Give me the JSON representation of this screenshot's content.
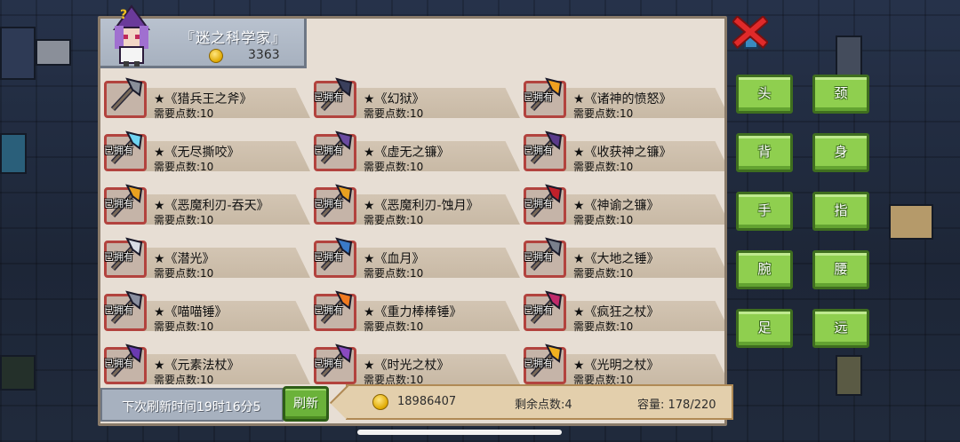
{
  "shop": {
    "title": "『迷之科学家』",
    "coins": "3363"
  },
  "items": [
    {
      "name": "★《猎兵王之斧》",
      "cost": "需要点数:10",
      "owned": "",
      "icon": "axe-icon",
      "color": "#8a8f99"
    },
    {
      "name": "★《幻狱》",
      "cost": "需要点数:10",
      "owned": "已拥有",
      "icon": "scythe-icon",
      "color": "#3a3f5c"
    },
    {
      "name": "★《诸神的愤怒》",
      "cost": "需要点数:10",
      "owned": "已拥有",
      "icon": "lightning-spear-icon",
      "color": "#f0a020"
    },
    {
      "name": "★《无尽撕咬》",
      "cost": "需要点数:10",
      "owned": "已拥有",
      "icon": "ice-blade-icon",
      "color": "#6fd4f2"
    },
    {
      "name": "★《虚无之镰》",
      "cost": "需要点数:10",
      "owned": "已拥有",
      "icon": "void-scythe-icon",
      "color": "#6a4aa0"
    },
    {
      "name": "★《收获神之镰》",
      "cost": "需要点数:10",
      "owned": "已拥有",
      "icon": "harvest-scythe-icon",
      "color": "#5a3a8a"
    },
    {
      "name": "★《恶魔利刃-吞天》",
      "cost": "需要点数:10",
      "owned": "已拥有",
      "icon": "demon-blade-icon",
      "color": "#e8a020"
    },
    {
      "name": "★《恶魔利刃-蚀月》",
      "cost": "需要点数:10",
      "owned": "已拥有",
      "icon": "demon-blade-icon",
      "color": "#e8a020"
    },
    {
      "name": "★《神谕之镰》",
      "cost": "需要点数:10",
      "owned": "已拥有",
      "icon": "oracle-scythe-icon",
      "color": "#c0202a"
    },
    {
      "name": "★《潜光》",
      "cost": "需要点数:10",
      "owned": "已拥有",
      "icon": "light-scythe-icon",
      "color": "#d8dce4"
    },
    {
      "name": "★《血月》",
      "cost": "需要点数:10",
      "owned": "已拥有",
      "icon": "blood-moon-icon",
      "color": "#3a7ac8"
    },
    {
      "name": "★《大地之锤》",
      "cost": "需要点数:10",
      "owned": "已拥有",
      "icon": "hammer-icon",
      "color": "#7a7f8c"
    },
    {
      "name": "★《喵喵锤》",
      "cost": "需要点数:10",
      "owned": "已拥有",
      "icon": "cat-hammer-icon",
      "color": "#8a8fa0"
    },
    {
      "name": "★《重力棒棒锤》",
      "cost": "需要点数:10",
      "owned": "已拥有",
      "icon": "gravity-hammer-icon",
      "color": "#f07a20"
    },
    {
      "name": "★《疯狂之杖》",
      "cost": "需要点数:10",
      "owned": "已拥有",
      "icon": "mad-staff-icon",
      "color": "#c02a6a"
    },
    {
      "name": "★《元素法杖》",
      "cost": "需要点数:10",
      "owned": "已拥有",
      "icon": "element-staff-icon",
      "color": "#6a3ab0"
    },
    {
      "name": "★《时光之杖》",
      "cost": "需要点数:10",
      "owned": "已拥有",
      "icon": "time-staff-icon",
      "color": "#8a4ac0"
    },
    {
      "name": "★《光明之杖》",
      "cost": "需要点数:10",
      "owned": "已拥有",
      "icon": "light-staff-icon",
      "color": "#f0b020"
    }
  ],
  "footer": {
    "refresh_time": "下次刷新时间19时16分5",
    "refresh_button": "刷新",
    "gold": "18986407",
    "points_left": "剩余点数:4",
    "capacity": "容量:  178/220"
  },
  "categories": [
    "头",
    "颈",
    "背",
    "身",
    "手",
    "指",
    "腕",
    "腰",
    "足",
    "远"
  ],
  "accent": {
    "green": "#8fcf4f",
    "red": "#b2433e"
  }
}
